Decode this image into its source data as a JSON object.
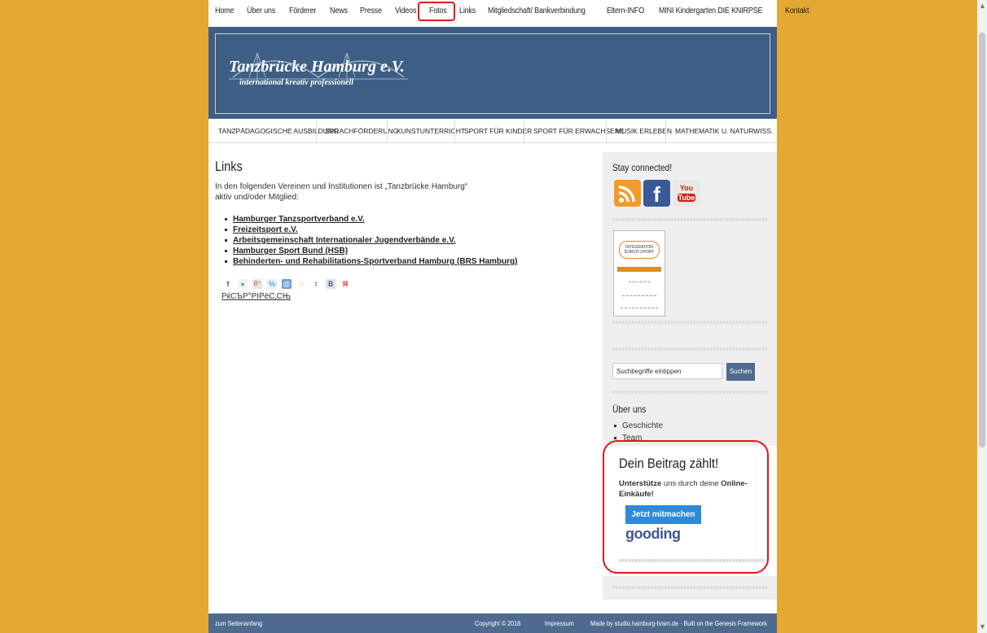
{
  "top_nav": [
    "Home",
    "Über uns",
    "Förderer",
    "News",
    "Presse",
    "Videos",
    "Fotos",
    "Links",
    "Mitgliedschaft/ Bankverbindung",
    "Eltern-INFO",
    "MINI Kindergarten DIE KNIRPSE",
    "Kontakt"
  ],
  "header": {
    "logo_title": "Tanzbrücke Hamburg e.V.",
    "logo_subtitle": "international kreativ professionell"
  },
  "sub_nav": [
    "TANZPÄDAGOGISCHE AUSBILDUNG",
    "SPRACHFÖRDERUNG",
    "KUNSTUNTERRICHT",
    "SPORT FÜR KINDER",
    "SPORT FÜR ERWACHSENE",
    "MUSIK ERLEBEN",
    "MATHEMATIK U. NATURWISS."
  ],
  "main": {
    "title": "Links",
    "intro_line1": "In den folgenden Vereinen und Institutionen ist „Tanzbrücke Hamburg“",
    "intro_line2": "aktiv und/oder Mitglied:",
    "links": [
      "Hamburger Tanzsportverband e.V.",
      "Freizeitsport e.V.",
      "Arbeitsgemeinschaft Internationaler Jugendverbände e.V.",
      "Hamburger Sport Bund (HSB)",
      "Behinderten- und Rehabilitations-Sportverband Hamburg (BRS Hamburg)"
    ],
    "share_link": "РќСЪР°РІРёС‚СЊ"
  },
  "sidebar": {
    "stay_connected": "Stay connected!",
    "youtube_top": "You",
    "youtube_bottom": "Tube",
    "badge_text": "INTEGRATION DURCH SPORT",
    "search_placeholder": "Suchbegriffe eintippen",
    "search_button": "Suchen",
    "about_title": "Über uns",
    "about_items": [
      "Geschichte",
      "Team"
    ]
  },
  "donate": {
    "title": "Dein Beitrag zählt!",
    "text_bold1": "Unterstütze",
    "text_mid": " uns durch deine ",
    "text_bold2": "Online-Einkäufe!",
    "button": "Jetzt mitmachen",
    "brand": "gooding"
  },
  "footer": {
    "back_to_top": "zum Seitenanfang",
    "copyright": "Copyright © 2018",
    "impressum": "Impressum",
    "made_by": "Made by studio.hamburg-hram.de · Built on the Genesis Framework"
  },
  "colors": {
    "background": "#e5a833",
    "header": "#3f5e85",
    "footer": "#4e6a8f",
    "highlight": "#e0161b",
    "donate_button": "#2e8ad8"
  }
}
